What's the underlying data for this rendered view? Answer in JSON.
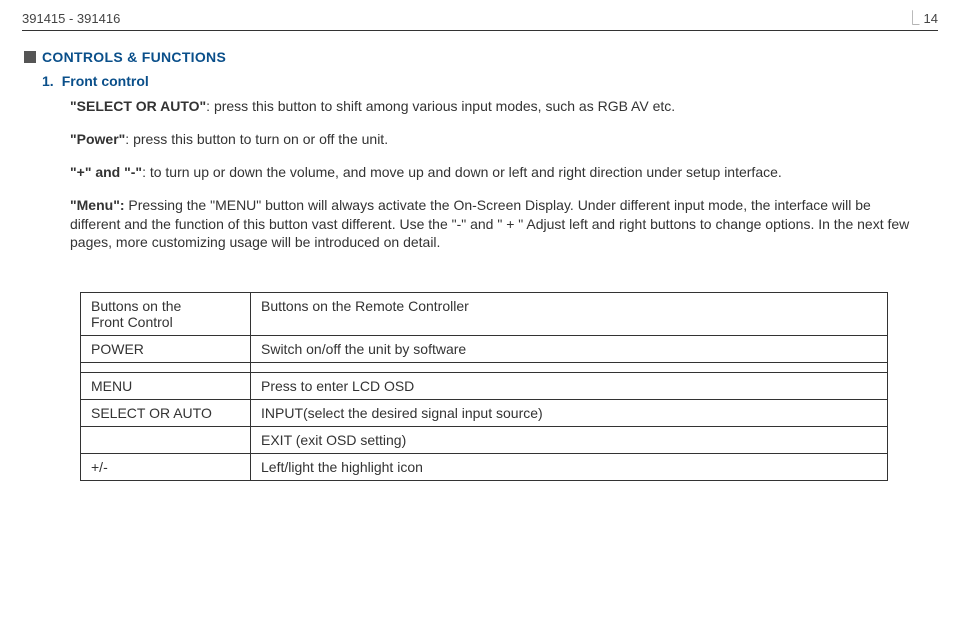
{
  "header": {
    "left": "391415 - 391416",
    "page": "14"
  },
  "section": {
    "title": "CONTROLS & FUNCTIONS"
  },
  "item1": {
    "number": "1.",
    "label": "Front control"
  },
  "paragraphs": {
    "p1_bold": "\"SELECT OR AUTO\"",
    "p1_rest": ": press this button to shift among various input modes, such as RGB AV etc.",
    "p2_bold": "\"Power\"",
    "p2_rest": ": press this button to turn on or off the unit.",
    "p3_bold": "\"+\" and \"-\"",
    "p3_rest": ": to turn up or down the volume, and move up and down or left and right direction under setup interface.",
    "p4_bold": "\"Menu\":",
    "p4_rest": " Pressing  the \"MENU\" button will always activate the On-Screen Display. Under different input mode, the interface will be different and the function of this button vast different. Use the \"-\" and \" + \" Adjust left and right buttons to change options. In the next few pages, more customizing usage will be introduced on detail."
  },
  "table": {
    "r1c1a": "Buttons on the",
    "r1c1b": "Front Control",
    "r1c2": "Buttons on the Remote Controller",
    "r2c1": "POWER",
    "r2c2": "Switch on/off the unit by software",
    "r3c1": "MENU",
    "r3c2": "Press to enter LCD OSD",
    "r4c1": "SELECT OR AUTO",
    "r4c2": "INPUT(select the desired signal input source)",
    "r5c1": "",
    "r5c2": "EXIT (exit OSD setting)",
    "r6c1": "+/-",
    "r6c2": "Left/light the highlight icon"
  }
}
